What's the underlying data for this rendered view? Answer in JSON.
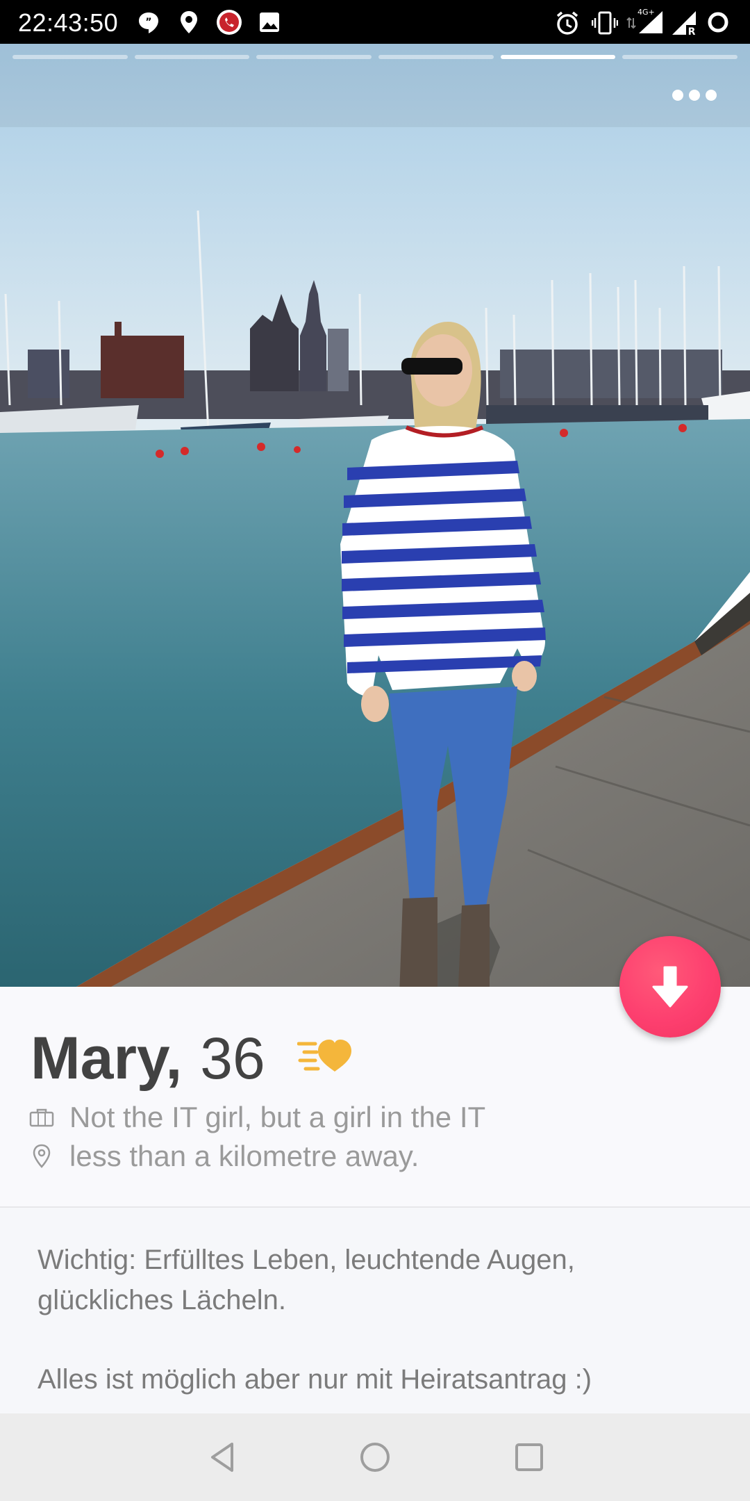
{
  "status_bar": {
    "time": "22:43:50",
    "icons_left": [
      "quote-icon",
      "location-pin-icon",
      "phone-record-icon",
      "image-icon"
    ],
    "icons_right": [
      "alarm-icon",
      "vibrate-icon",
      "4g-signal-icon",
      "signal-r-icon",
      "circle-status-icon"
    ],
    "network_label": "4G+"
  },
  "photo": {
    "progress_segments": 6,
    "active_segment": 5,
    "more_button": "more-icon"
  },
  "profile": {
    "name": "Mary,",
    "age": "36",
    "job": "Not the IT girl, but a girl in the IT",
    "distance": "less than a kilometre away."
  },
  "bio": {
    "line1": "Wichtig: Erfülltes Leben, leuchtende Augen,",
    "line2": "glückliches Lächeln.",
    "line3": "Alles ist möglich aber nur mit Heiratsantrag :)"
  },
  "colors": {
    "accent_fab": "#fd3f6f",
    "boost_gold": "#f4b63b",
    "name_text": "#424242",
    "secondary_text": "#9a9a9a"
  }
}
